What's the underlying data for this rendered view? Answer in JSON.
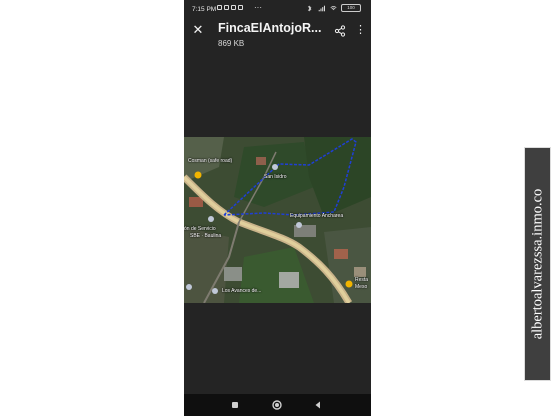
{
  "status_bar": {
    "time": "7:15 PM",
    "more": "···",
    "battery": "100"
  },
  "viewer": {
    "title": "FincaElAntojoR...",
    "file_size": "869 KB",
    "icons": [
      "close-icon",
      "share-icon",
      "more-vert-icon"
    ]
  },
  "map": {
    "labels": {
      "road_place": "Cosman (safe road)",
      "san_isidro": "San Isidro",
      "equipamiento": "Equipamiento Ancharea",
      "service": "ón de Servicio",
      "service_2": "SBE · Baulina",
      "resto": "Resta",
      "resto_2": "Meso",
      "avances": "Los Avances de..."
    },
    "boundary_color": "#1f3fd6"
  },
  "nav_bar": {
    "icons": [
      "recents-square-icon",
      "home-circle-icon",
      "back-triangle-icon"
    ]
  },
  "watermark": {
    "text": "albertoalvarezssa.inmo.co"
  }
}
